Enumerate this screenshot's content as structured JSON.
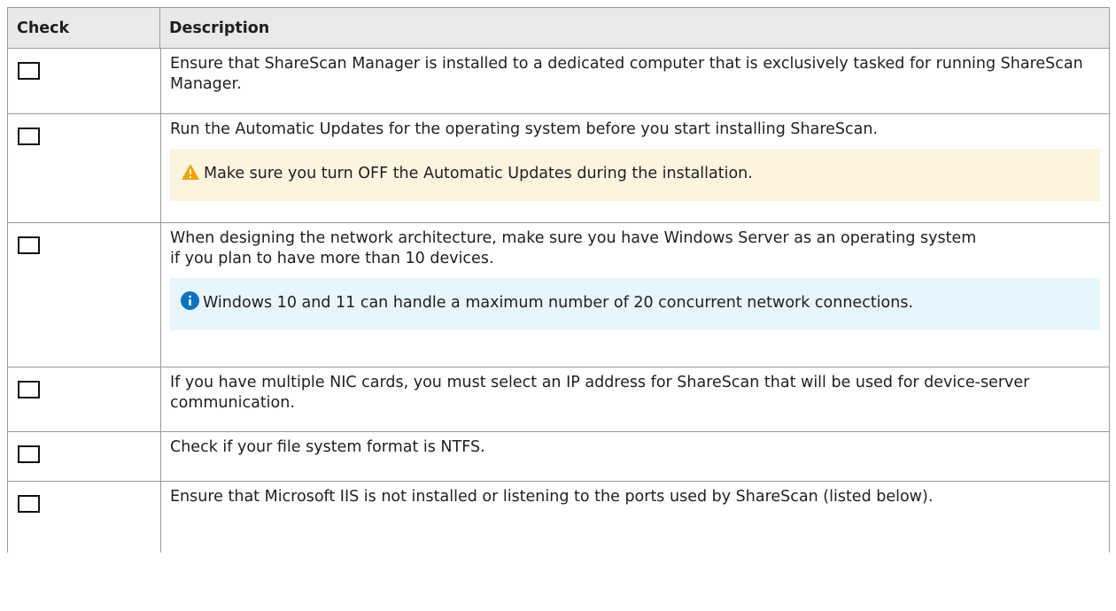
{
  "table": {
    "headers": {
      "check": "Check",
      "description": "Description"
    },
    "rows": [
      {
        "checked": false,
        "text": "Ensure that ShareScan Manager is installed to a dedicated computer that is exclusively tasked for running ShareScan Manager."
      },
      {
        "checked": false,
        "text": "Run the Automatic Updates for the operating system before you start installing ShareScan.",
        "note": {
          "kind": "warning",
          "icon": "warning-triangle-icon",
          "text": "Make sure you turn OFF the Automatic Updates during the installation."
        }
      },
      {
        "checked": false,
        "text": "When designing the network architecture, make sure you have Windows Server as an operating system if you plan to have more than 10 devices.",
        "note": {
          "kind": "info",
          "icon": "info-circle-icon",
          "text": "Windows 10 and 11 can handle a maximum number of 20 concurrent network connections."
        }
      },
      {
        "checked": false,
        "text": "If you have multiple NIC cards, you must select an IP address for ShareScan that will be used for device-server communication."
      },
      {
        "checked": false,
        "text": "Check if your file system format is NTFS."
      },
      {
        "checked": false,
        "text": "Ensure that Microsoft IIS is not installed or listening to the ports used by ShareScan (listed below)."
      }
    ]
  },
  "colors": {
    "warning_bg": "#fdf4e0",
    "warning_icon": "#f0a400",
    "info_bg": "#e7f5fc",
    "info_icon": "#0e72c2",
    "header_bg": "#e9e9e9"
  }
}
